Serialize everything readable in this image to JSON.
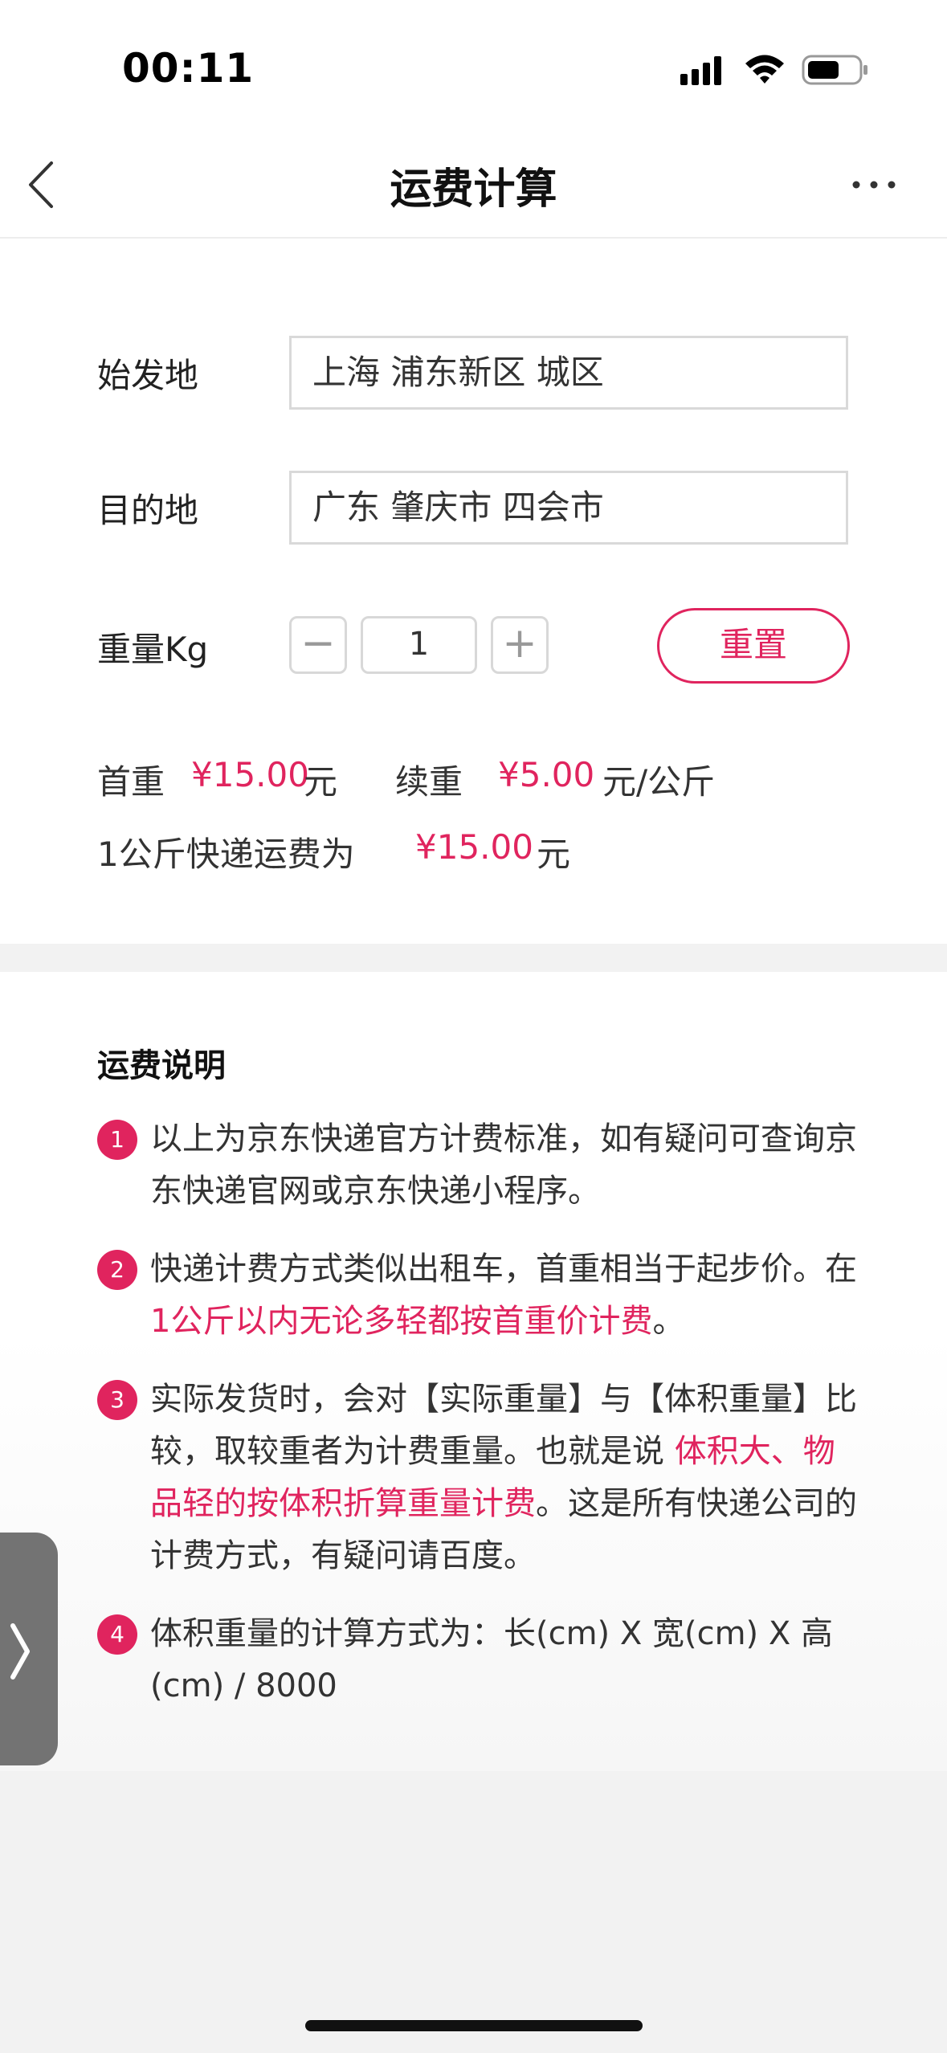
{
  "status_bar": {
    "time": "00:11"
  },
  "nav": {
    "title": "运费计算"
  },
  "form": {
    "origin_label": "始发地",
    "origin_value": "上海 浦东新区 城区",
    "destination_label": "目的地",
    "destination_value": "广东 肇庆市 四会市",
    "weight_label": "重量Kg",
    "minus_symbol": "−",
    "weight_value": "1",
    "plus_symbol": "+",
    "reset_label": "重置"
  },
  "pricing": {
    "first_weight_label": "首重",
    "first_weight_price": "¥15.00",
    "first_weight_unit": "元",
    "extra_weight_label": "续重",
    "extra_weight_price": "¥5.00",
    "extra_weight_unit": "元/公斤",
    "total_label": "1公斤快递运费为",
    "total_price": "¥15.00",
    "total_unit": "元"
  },
  "explanation": {
    "title": "运费说明",
    "items": [
      {
        "number": "1",
        "text": "以上为京东快递官方计费标准，如有疑问可查询京东快递官网或京东快递小程序。"
      },
      {
        "number": "2",
        "text_before": "快递计费方式类似出租车，首重相当于起步价。在 ",
        "highlight": "1公斤以内无论多轻都按首重价计费",
        "text_after": "。"
      },
      {
        "number": "3",
        "text_before": "实际发货时，会对【实际重量】与【体积重量】比较，取较重者为计费重量。也就是说 ",
        "highlight": "体积大、物品轻的按体积折算重量计费",
        "text_after": "。这是所有快递公司的计费方式，有疑问请百度。"
      },
      {
        "number": "4",
        "text": "体积重量的计算方式为：长(cm) X 宽(cm) X 高(cm) / 8000"
      }
    ]
  },
  "icons": {
    "back": "back-chevron-icon",
    "more": "more-dots-icon",
    "signal": "cellular-signal-icon",
    "wifi": "wifi-icon",
    "battery": "battery-icon",
    "side_tab": "chevron-right-icon"
  },
  "colors": {
    "accent": "#e0245e",
    "border": "#d9d9d9",
    "page_bg": "#f2f2f2"
  }
}
